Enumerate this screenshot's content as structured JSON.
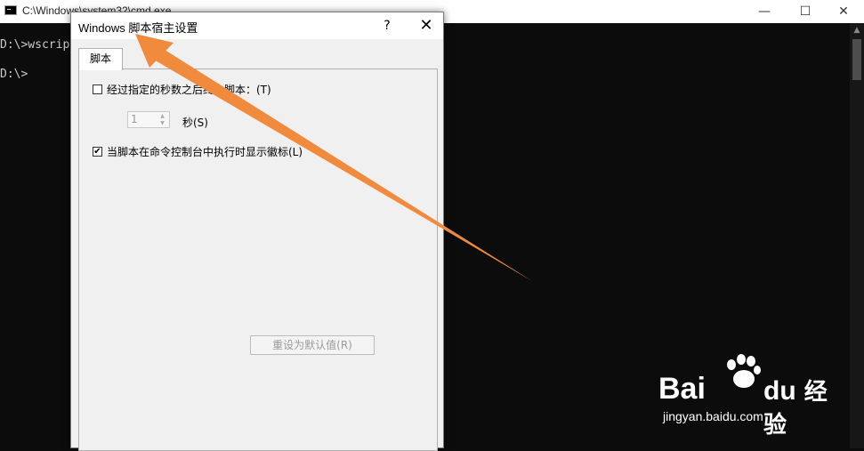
{
  "console": {
    "title": "C:\\Windows\\system32\\cmd.exe",
    "minimize": "—",
    "maximize": "☐",
    "close": "✕",
    "lines": [
      "D:\\>wscript",
      "D:\\>"
    ]
  },
  "dialog": {
    "title": "Windows 脚本宿主设置",
    "help": "?",
    "close": "✕",
    "tab_label": "脚本",
    "stop_script_checkbox": {
      "label": "经过指定的秒数之后终止脚本：(T)",
      "checked": false
    },
    "seconds_value": "1",
    "seconds_label": "秒(S)",
    "show_logo_checkbox": {
      "label": "当脚本在命令控制台中执行时显示徽标(L)",
      "checked": true,
      "mark": "✔"
    },
    "reset_button": "重设为默认值(R)"
  },
  "annotation": {
    "color": "#f08a3c"
  },
  "watermark": {
    "brand_left": "Bai",
    "brand_right": "du",
    "product": "经验",
    "url": "jingyan.baidu.com"
  }
}
